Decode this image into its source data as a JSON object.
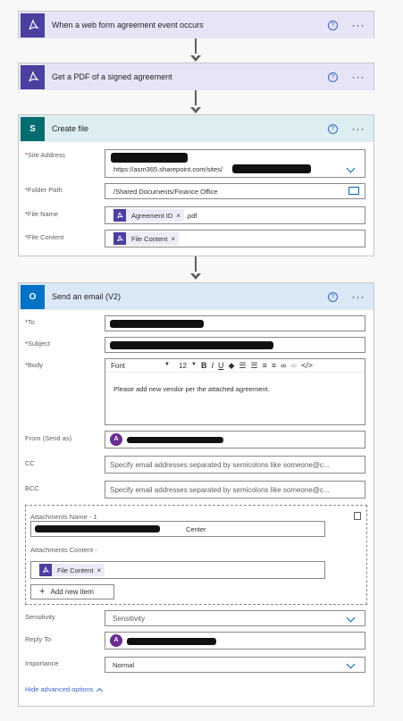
{
  "colors": {
    "adobe": "#4b3fa0",
    "sharepoint": "#036c70",
    "outlook": "#0072c6",
    "link": "#3a66c5"
  },
  "trigger": {
    "title": "When a web form agreement event occurs"
  },
  "get_pdf": {
    "title": "Get a PDF of a signed agreement"
  },
  "create_file": {
    "title": "Create file",
    "site_address_label": "Site Address",
    "site_address_value": "https://asm365.sharepoint.com/sites/",
    "folder_path_label": "Folder Path",
    "folder_path_value": "/Shared Documents/Finance Office",
    "file_name_label": "File Name",
    "file_name_token": "Agreement ID",
    "file_name_suffix": ".pdf",
    "file_content_label": "File Content",
    "file_content_token": "File Content"
  },
  "send_email": {
    "title": "Send an email (V2)",
    "to_label": "To",
    "subject_label": "Subject",
    "body_label": "Body",
    "font_label": "Font",
    "font_size": "12",
    "body_text": "Please add new vendor per the attached agreement.",
    "from_label": "From (Send as)",
    "cc_label": "CC",
    "cc_placeholder": "Specify email addresses separated by semicolons like someone@c...",
    "bcc_label": "BCC",
    "bcc_placeholder": "Specify email addresses separated by semicolons like someone@c...",
    "attachments_name_label": "Attachments Name - 1",
    "attachments_name_suffix": "Center",
    "attachments_content_label": "Attachments Content -",
    "attachments_content_token": "File Content",
    "add_new_item_label": "Add new item",
    "sensitivity_label": "Sensitivity",
    "sensitivity_placeholder": "Sensitivity",
    "reply_to_label": "Reply To",
    "importance_label": "Importance",
    "importance_value": "Normal",
    "hide_advanced_label": "Hide advanced options",
    "avatar_initial": "A"
  },
  "icons": [
    "adobe-sign-icon",
    "sharepoint-icon",
    "outlook-icon",
    "help-icon",
    "more-options-icon",
    "folder-icon",
    "chevron-down-icon",
    "copy-icon",
    "plus-icon",
    "chevron-up-icon"
  ]
}
